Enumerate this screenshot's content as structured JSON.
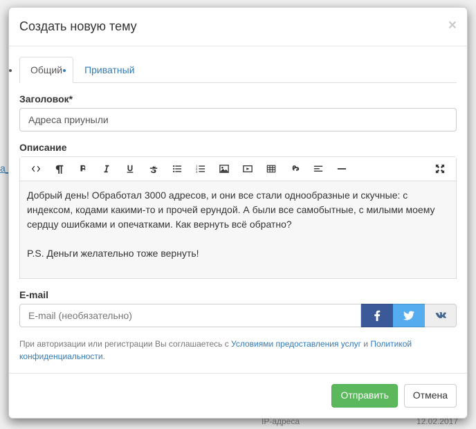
{
  "modal": {
    "title": "Создать новую тему",
    "tabs": {
      "general": "Общий",
      "private": "Приватный"
    },
    "labels": {
      "title": "Заголовок*",
      "description": "Описание",
      "email": "E-mail"
    },
    "fields": {
      "title_value": "Адреса приуныли",
      "email_placeholder": "E-mail (необязательно)"
    },
    "description_body": {
      "p1": "Добрый день! Обработал 3000 адресов, и они все стали однообразные и скучные: с индексом, кодами какими-то и прочей ерундой. А были все самобытные, с милыми моему сердцу ошибками и опечатками. Как вернуть всё обратно?",
      "p2": "P.S. Деньги желательно тоже вернуть!"
    },
    "legal": {
      "prefix": "При авторизации или регистрации Вы соглашаетесь с ",
      "tos": "Условиями предоставления услуг",
      "and": " и ",
      "privacy": "Политикой конфиденциальности",
      "suffix": "."
    },
    "buttons": {
      "submit": "Отправить",
      "cancel": "Отмена"
    }
  },
  "background": {
    "left_link": "а_",
    "bottom_label": "IP-адреса",
    "bottom_date": "12.02.2017"
  },
  "icons": {
    "close": "×"
  }
}
